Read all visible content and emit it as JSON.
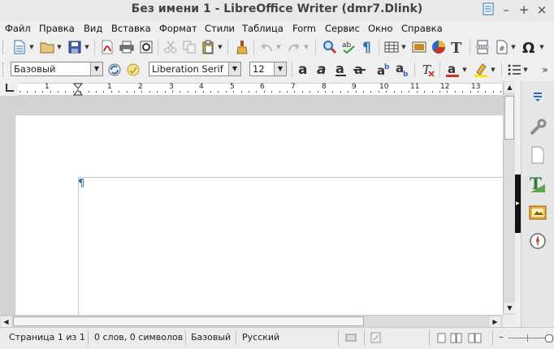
{
  "window": {
    "title": "Без имени 1 - LibreOffice Writer (dmr7.Dlink)"
  },
  "menubar": {
    "items": [
      {
        "label": "Файл"
      },
      {
        "label": "Правка"
      },
      {
        "label": "Вид"
      },
      {
        "label": "Вставка"
      },
      {
        "label": "Формат"
      },
      {
        "label": "Стили"
      },
      {
        "label": "Таблица"
      },
      {
        "label": "Form"
      },
      {
        "label": "Сервис"
      },
      {
        "label": "Окно"
      },
      {
        "label": "Справка"
      }
    ]
  },
  "formatting": {
    "paragraph_style": "Базовый",
    "font_name": "Liberation Serif",
    "font_size": "12"
  },
  "ruler": {
    "marks": [
      "1",
      "1",
      "2",
      "3",
      "4",
      "5",
      "6",
      "7",
      "8",
      "9",
      "10",
      "11",
      "12",
      "13"
    ]
  },
  "document": {
    "paragraph_mark": "¶"
  },
  "statusbar": {
    "page": "Страница 1 из 1",
    "words": "0 слов, 0 символов",
    "style": "Базовый",
    "language": "Русский"
  },
  "colors": {
    "accent_blue": "#2a6db5",
    "page_bg": "#ffffff",
    "workspace_bg": "#d4d4d4"
  }
}
